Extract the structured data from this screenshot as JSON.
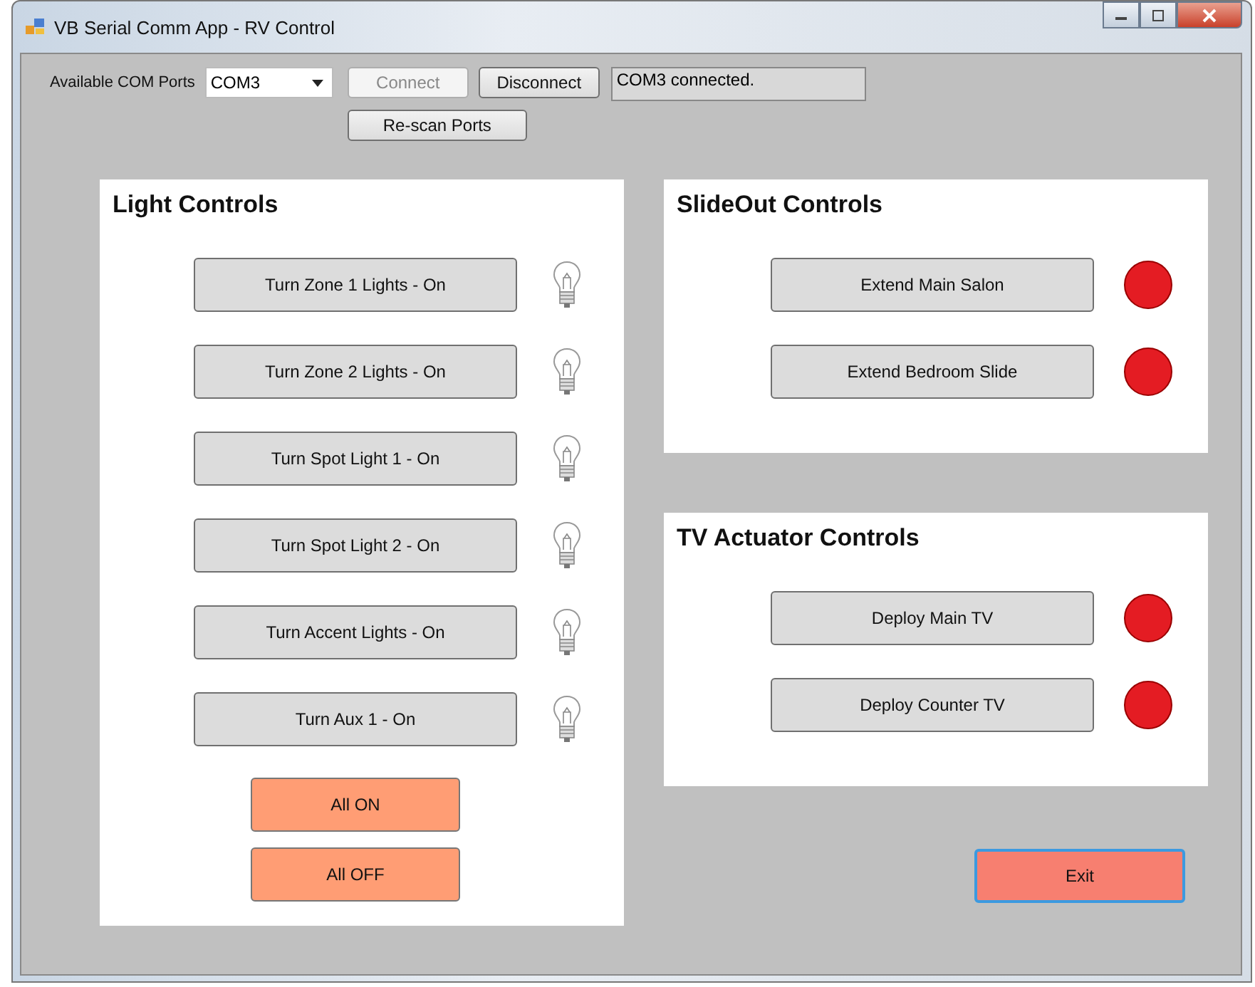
{
  "window": {
    "title": "VB Serial Comm App - RV Control"
  },
  "connection": {
    "label": "Available COM Ports",
    "port": "COM3",
    "buttons": [
      {
        "label": "Connect",
        "disabled": true
      },
      {
        "label": "Disconnect",
        "disabled": false
      }
    ],
    "status": "COM3 connected.",
    "rescan": "Re-scan Ports"
  },
  "light_controls": {
    "title": "Light Controls",
    "items": [
      {
        "label": "Turn Zone 1 Lights - On",
        "lit": false
      },
      {
        "label": "Turn Zone 2 Lights - On",
        "lit": false
      },
      {
        "label": "Turn Spot Light 1 - On",
        "lit": false
      },
      {
        "label": "Turn Spot Light 2 - On",
        "lit": false
      },
      {
        "label": "Turn Accent Lights - On",
        "lit": false
      },
      {
        "label": "Turn Aux 1 - On",
        "lit": false
      }
    ],
    "all_buttons": [
      "All ON",
      "All OFF"
    ]
  },
  "slideout_controls": {
    "title": "SlideOut Controls",
    "items": [
      {
        "label": "Extend Main Salon",
        "color": "#e41c23"
      },
      {
        "label": "Extend Bedroom Slide",
        "color": "#e41c23"
      }
    ]
  },
  "tv_controls": {
    "title": "TV Actuator Controls",
    "items": [
      {
        "label": "Deploy Main TV",
        "color": "#e41c23"
      },
      {
        "label": "Deploy Counter TV",
        "color": "#e41c23"
      }
    ]
  },
  "exit_button": "Exit"
}
